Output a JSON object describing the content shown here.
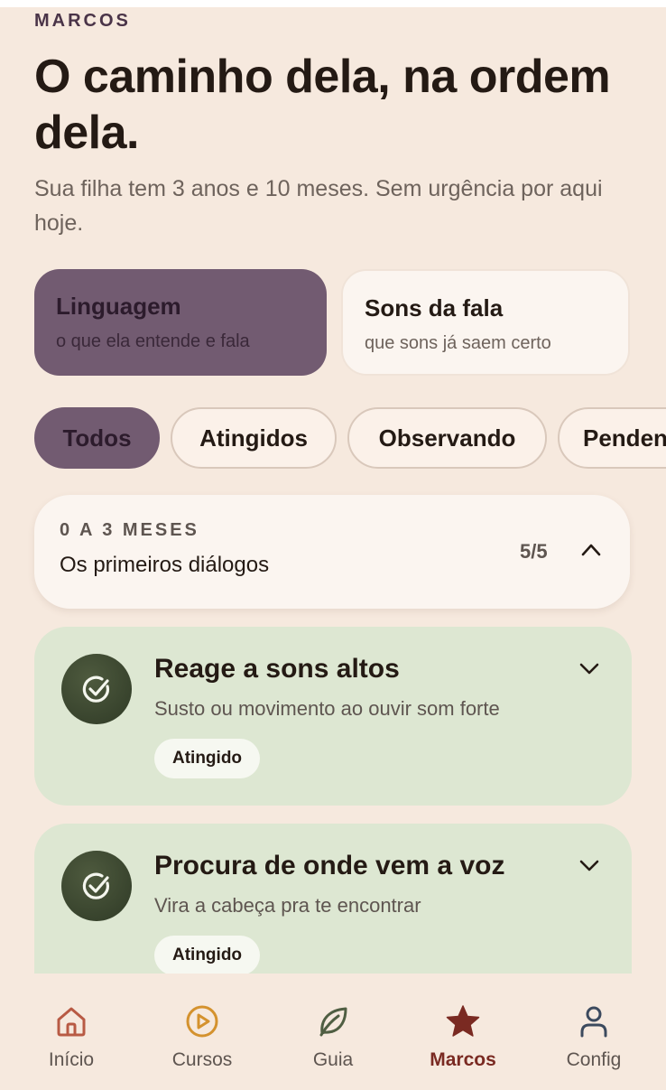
{
  "header": {
    "eyebrow": "MARCOS",
    "title": "O caminho dela, na ordem dela.",
    "subtitle": "Sua filha tem 3 anos e 10 meses. Sem urgência por aqui hoje."
  },
  "areas": [
    {
      "name": "Linguagem",
      "desc": "o que ela entende e fala",
      "active": true
    },
    {
      "name": "Sons da fala",
      "desc": "que sons já saem certo",
      "active": false
    }
  ],
  "filters": [
    {
      "label": "Todos",
      "active": true
    },
    {
      "label": "Atingidos",
      "active": false
    },
    {
      "label": "Observando",
      "active": false
    },
    {
      "label": "Pendentes",
      "active": false
    }
  ],
  "group": {
    "range": "0 A 3 MESES",
    "name": "Os primeiros diálogos",
    "count": "5/5"
  },
  "milestones": [
    {
      "title": "Reage a sons altos",
      "desc": "Susto ou movimento ao ouvir som forte",
      "status": "Atingido"
    },
    {
      "title": "Procura de onde vem a voz",
      "desc": "Vira a cabeça pra te encontrar",
      "status": "Atingido"
    }
  ],
  "nav": [
    {
      "label": "Início",
      "icon": "home-icon"
    },
    {
      "label": "Cursos",
      "icon": "play-circle-icon"
    },
    {
      "label": "Guia",
      "icon": "leaf-icon"
    },
    {
      "label": "Marcos",
      "icon": "star-icon",
      "active": true
    },
    {
      "label": "Config",
      "icon": "user-icon"
    }
  ],
  "colors": {
    "background": "#f6e9de",
    "accent_purple": "#725b71",
    "milestone_green": "#dde7d2",
    "check_dark": "#3a4530",
    "nav_active": "#7a2a22"
  }
}
